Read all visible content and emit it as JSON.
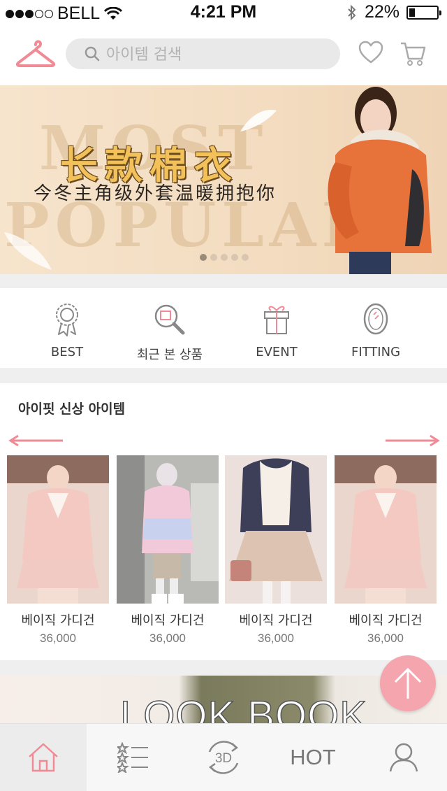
{
  "status_bar": {
    "carrier": "BELL",
    "time": "4:21 PM",
    "battery_percent": "22%",
    "battery_level": 0.22,
    "signal_bars_filled": 3,
    "signal_bars_total": 5
  },
  "header": {
    "logo_icon": "hanger-icon",
    "search_placeholder": "아이템 검색",
    "wishlist_icon": "heart-icon",
    "cart_icon": "cart-icon"
  },
  "banner": {
    "title": "长款棉衣",
    "subtitle": "今冬主角级外套温暖拥抱你",
    "background_text_1": "MOST",
    "background_text_2": "POPULAR",
    "slide_count": 5,
    "active_slide": 1
  },
  "quick_menu": [
    {
      "label": "BEST",
      "icon": "medal-icon"
    },
    {
      "label": "최근 본 상품",
      "icon": "magnifier-icon"
    },
    {
      "label": "EVENT",
      "icon": "gift-icon"
    },
    {
      "label": "FITTING",
      "icon": "mirror-icon"
    }
  ],
  "new_items": {
    "title": "아이핏 신상 아이템",
    "products": [
      {
        "name": "베이직 가디건",
        "price": "36,000"
      },
      {
        "name": "베이직 가디건",
        "price": "36,000"
      },
      {
        "name": "베이직 가디건",
        "price": "36,000"
      },
      {
        "name": "베이직 가디건",
        "price": "36,000"
      }
    ]
  },
  "lookbook": {
    "title": "LOOK BOOK"
  },
  "tabbar": [
    {
      "name": "home",
      "icon": "home-icon",
      "active": true
    },
    {
      "name": "category",
      "icon": "list-icon",
      "active": false
    },
    {
      "name": "3d",
      "icon": "3d-rotate-icon",
      "label": "3D",
      "active": false
    },
    {
      "name": "hot",
      "label": "HOT",
      "active": false
    },
    {
      "name": "my",
      "icon": "user-icon",
      "active": false
    }
  ],
  "colors": {
    "accent": "#f08b96",
    "fab": "#f5a5ae"
  }
}
